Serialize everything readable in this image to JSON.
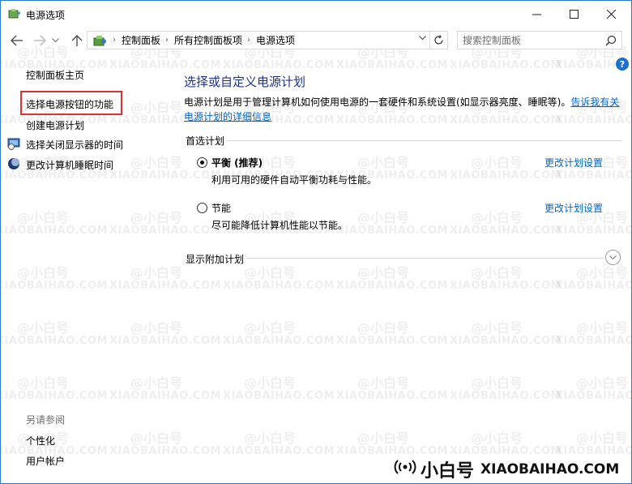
{
  "window": {
    "title": "电源选项"
  },
  "nav": {
    "breadcrumbs": [
      "控制面板",
      "所有控制面板项",
      "电源选项"
    ],
    "search_placeholder": "搜索控制面板"
  },
  "left_pane": {
    "home": "控制面板主页",
    "items": [
      {
        "label": "选择电源按钮的功能",
        "highlighted": true
      },
      {
        "label": "创建电源计划"
      },
      {
        "label": "选择关闭显示器的时间",
        "icon": "monitor-icon"
      },
      {
        "label": "更改计算机睡眠时间",
        "icon": "moon-icon"
      }
    ],
    "see_also": "另请参阅",
    "see_also_items": [
      "个性化",
      "用户帐户"
    ]
  },
  "main": {
    "title": "选择或自定义电源计划",
    "description": "电源计划是用于管理计算机如何使用电源的一套硬件和系统设置(如显示器亮度、睡眠等)。",
    "description_link_part1": "告诉我有关",
    "description_link_part2": "电源计划的详细信息",
    "preferred_label": "首选计划",
    "plans": [
      {
        "name": "平衡 (推荐)",
        "desc": "利用可用的硬件自动平衡功耗与性能。",
        "selected": true,
        "change": "更改计划设置"
      },
      {
        "name": "节能",
        "desc": "尽可能降低计算机性能以节能。",
        "selected": false,
        "change": "更改计划设置"
      }
    ],
    "additional_label": "显示附加计划"
  },
  "watermark": {
    "cn": "@小白号",
    "en": "XIAOBAIHAO.COM"
  },
  "brand": {
    "cn": "小白号",
    "en": "XIAOBAIHAO.COM"
  },
  "colors": {
    "title_blue": "#1e3287",
    "link_blue": "#0066cc",
    "highlight_red": "#e03131",
    "help_blue": "#1e6fc8"
  }
}
